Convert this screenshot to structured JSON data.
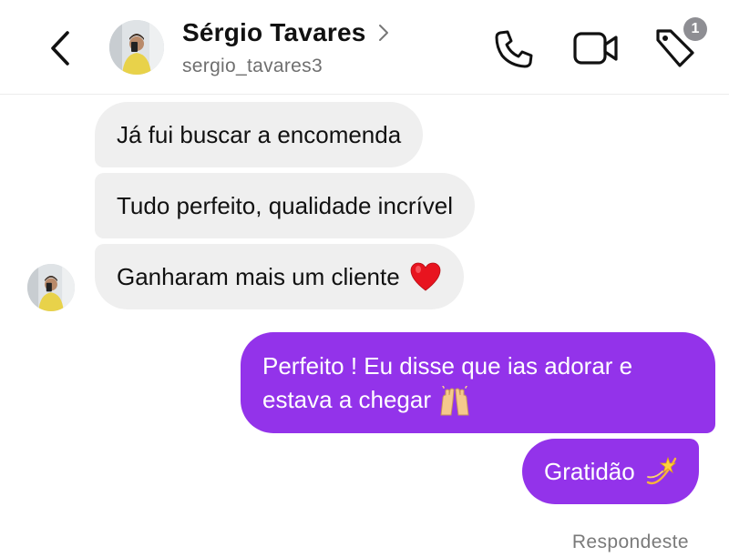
{
  "header": {
    "contact_name": "Sérgio Tavares",
    "username": "sergio_tavares3",
    "notification_count": "1",
    "icons": [
      "back-arrow-icon",
      "chevron-right-icon",
      "phone-icon",
      "video-camera-icon",
      "tag-icon"
    ]
  },
  "messages": [
    {
      "direction": "received",
      "text": "Já fui buscar a encomenda"
    },
    {
      "direction": "received",
      "text": "Tudo perfeito, qualidade incrível"
    },
    {
      "direction": "received",
      "text": "Ganharam mais um cliente",
      "emoji": "red-heart"
    },
    {
      "direction": "sent",
      "text": "Perfeito ! Eu disse que ias adorar e estava a chegar",
      "emoji": "raised-hands"
    },
    {
      "direction": "sent",
      "text": "Gratidão",
      "emoji": "dizzy-star"
    }
  ],
  "status": "Respondeste",
  "colors": {
    "sent_bubble": "#9333ea",
    "received_bubble": "#efefef",
    "badge": "#8e8e93"
  }
}
